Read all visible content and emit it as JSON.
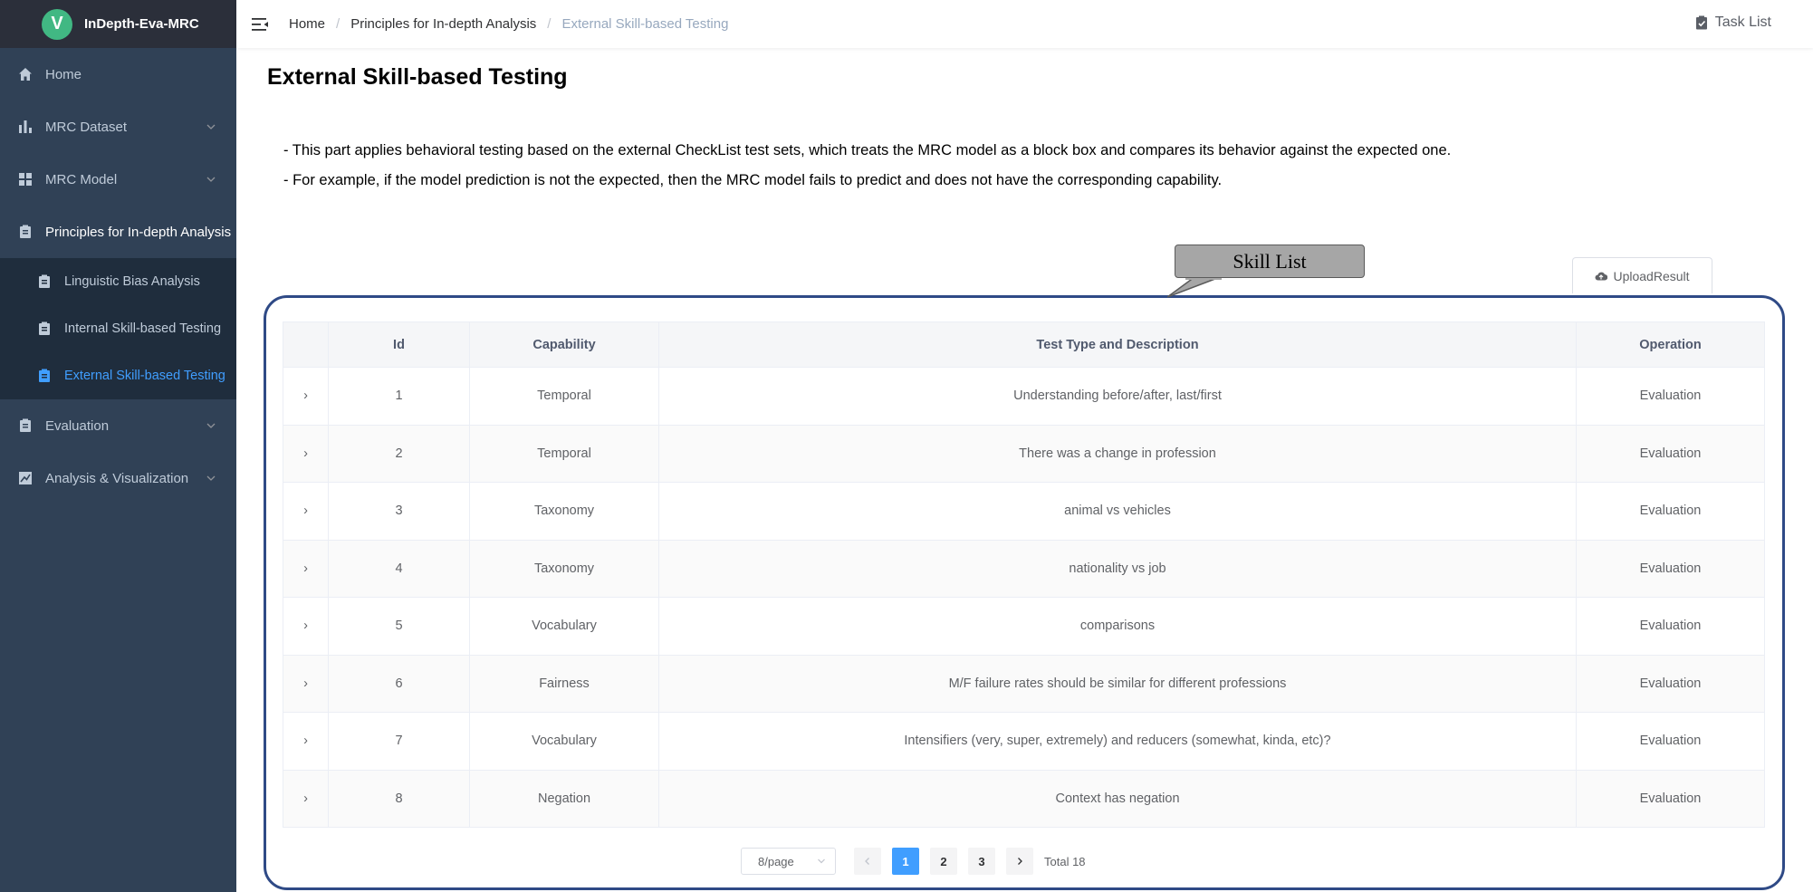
{
  "app": {
    "logo_letter": "V",
    "name": "InDepth-Eva-MRC"
  },
  "sidebar": {
    "items": [
      {
        "label": "Home",
        "icon": "home-icon"
      },
      {
        "label": "MRC Dataset",
        "icon": "bar-chart-icon"
      },
      {
        "label": "MRC Model",
        "icon": "grid-icon"
      },
      {
        "label": "Principles for In-depth Analysis",
        "icon": "clipboard-icon"
      },
      {
        "label": "Evaluation",
        "icon": "clipboard-icon"
      },
      {
        "label": "Analysis & Visualization",
        "icon": "line-chart-icon"
      }
    ],
    "submenu": [
      {
        "label": "Linguistic Bias Analysis"
      },
      {
        "label": "Internal Skill-based Testing"
      },
      {
        "label": "External Skill-based Testing"
      }
    ]
  },
  "breadcrumb": [
    "Home",
    "Principles for In-depth Analysis",
    "External Skill-based Testing"
  ],
  "header": {
    "task_list": "Task List"
  },
  "page": {
    "title": "External Skill-based Testing",
    "desc1": "- This part applies behavioral testing based on the external CheckList test sets, which treats the MRC model as a block box and compares its behavior against the expected one.",
    "desc2": "- For example, if the model prediction is not the expected, then the MRC model fails to predict and does not have the corresponding capability.",
    "callout": "Skill List",
    "upload_label": "UploadResult"
  },
  "table": {
    "columns": [
      "",
      "Id",
      "Capability",
      "Test Type and Description",
      "Operation"
    ],
    "rows": [
      {
        "id": "1",
        "capability": "Temporal",
        "description": "Understanding before/after, last/first",
        "operation": "Evaluation"
      },
      {
        "id": "2",
        "capability": "Temporal",
        "description": "There was a change in profession",
        "operation": "Evaluation"
      },
      {
        "id": "3",
        "capability": "Taxonomy",
        "description": "animal vs vehicles",
        "operation": "Evaluation"
      },
      {
        "id": "4",
        "capability": "Taxonomy",
        "description": "nationality vs job",
        "operation": "Evaluation"
      },
      {
        "id": "5",
        "capability": "Vocabulary",
        "description": "comparisons",
        "operation": "Evaluation"
      },
      {
        "id": "6",
        "capability": "Fairness",
        "description": "M/F failure rates should be similar for different professions",
        "operation": "Evaluation"
      },
      {
        "id": "7",
        "capability": "Vocabulary",
        "description": "Intensifiers (very, super, extremely) and reducers (somewhat, kinda, etc)?",
        "operation": "Evaluation"
      },
      {
        "id": "8",
        "capability": "Negation",
        "description": "Context has negation",
        "operation": "Evaluation"
      }
    ]
  },
  "pagination": {
    "page_size": "8/page",
    "pages": [
      "1",
      "2",
      "3"
    ],
    "current": "1",
    "total": "Total 18"
  },
  "colors": {
    "sidebar_bg": "#304156",
    "accent": "#409eff",
    "frame": "#2f4a86"
  }
}
